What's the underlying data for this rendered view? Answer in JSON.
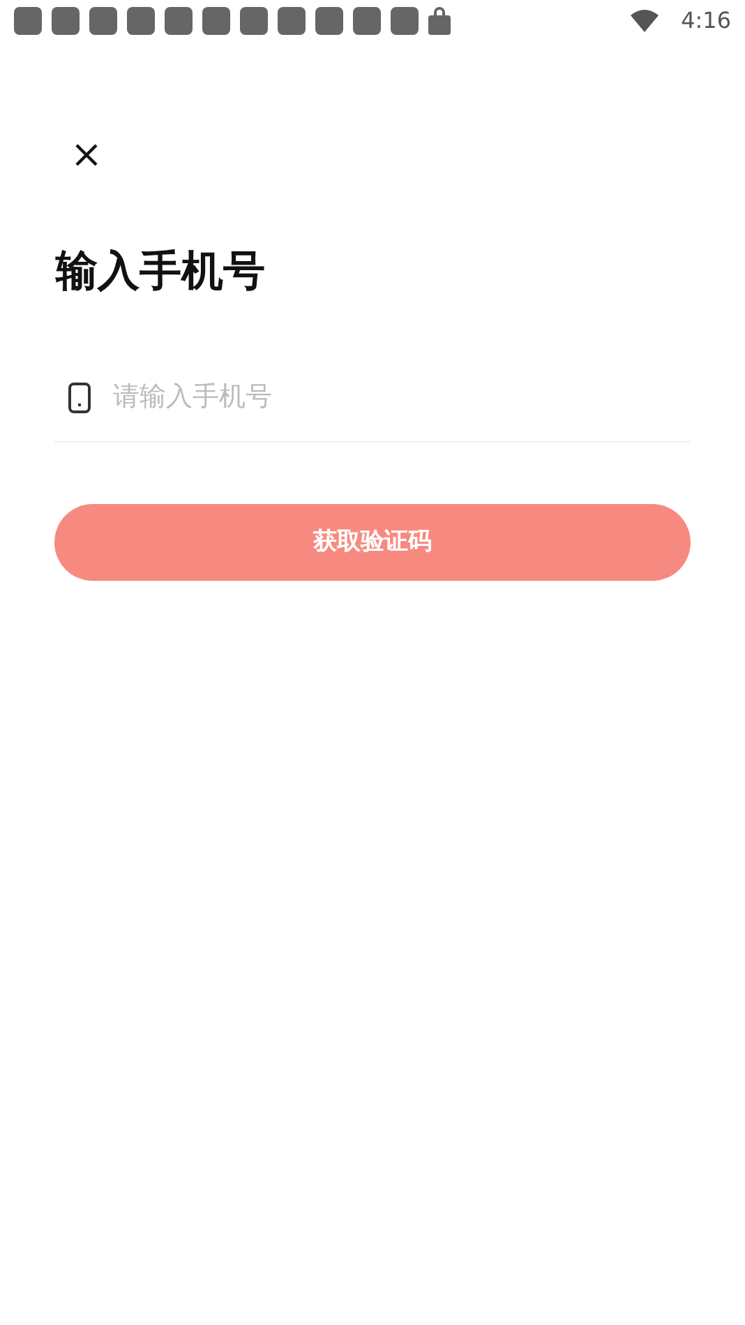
{
  "status_bar": {
    "time": "4:16"
  },
  "heading": "输入手机号",
  "phone_field": {
    "placeholder": "请输入手机号"
  },
  "submit_button": {
    "label": "获取验证码"
  }
}
